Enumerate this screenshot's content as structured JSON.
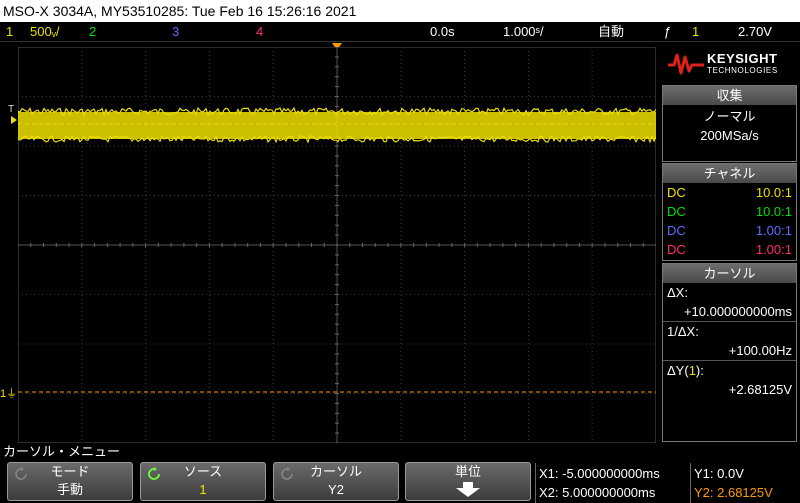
{
  "title": "MSO-X 3034A, MY53510285: Tue Feb 16 15:26:16 2021",
  "status": {
    "ch1_num": "1",
    "ch1_scale": "500ᵥ/",
    "ch2_num": "2",
    "ch3_num": "3",
    "ch4_num": "4",
    "time_pos": "0.0s",
    "time_scale": "1.000ˢ/",
    "trigger_mode": "自動",
    "trigger_symbol": "ƒ",
    "trigger_source": "1",
    "trigger_level": "2.70V"
  },
  "grid_markers": {
    "trigger_label": "T",
    "ground_label": "1"
  },
  "logo": {
    "brand": "KEYSIGHT",
    "sub": "TECHNOLOGIES"
  },
  "acquisition": {
    "heading": "収集",
    "mode": "ノーマル",
    "rate": "200MSa/s"
  },
  "channels": {
    "heading": "チャネル",
    "rows": [
      {
        "coupling": "DC",
        "probe": "10.0:1",
        "color": "#f0e000"
      },
      {
        "coupling": "DC",
        "probe": "10.0:1",
        "color": "#00e000"
      },
      {
        "coupling": "DC",
        "probe": "1.00:1",
        "color": "#5a6cff"
      },
      {
        "coupling": "DC",
        "probe": "1.00:1",
        "color": "#ff2a6a"
      }
    ]
  },
  "cursors_panel": {
    "heading": "カーソル",
    "dx_label": "ΔX:",
    "dx_value": "+10.000000000ms",
    "inv_dx_label": "1/ΔX:",
    "inv_dx_value": "+100.00Hz",
    "dy_label_pre": "ΔY(",
    "dy_label_ch": "1",
    "dy_label_post": "):",
    "dy_value": "+2.68125V"
  },
  "menu": {
    "title": "カーソル・メニュー",
    "softkeys": [
      {
        "label": "モード",
        "value": "手動"
      },
      {
        "label": "ソース",
        "value": "1"
      },
      {
        "label": "カーソル",
        "value": "Y2"
      },
      {
        "label": "単位",
        "value": ""
      }
    ]
  },
  "readout": {
    "x1": "X1: -5.000000000ms",
    "x2": "X2: 5.000000000ms",
    "y1": "Y1: 0.0V",
    "y2": "Y2: 2.68125V"
  },
  "colors": {
    "ch1": "#f0e000",
    "ch2": "#00e000",
    "ch3": "#5a6cff",
    "ch4": "#ff2a6a",
    "cursor": "#ff9900"
  }
}
